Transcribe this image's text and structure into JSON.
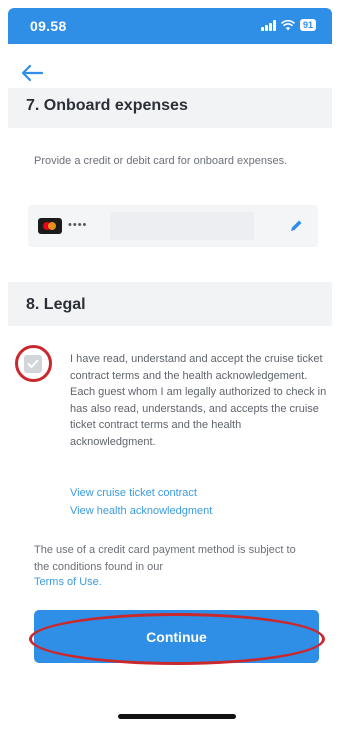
{
  "status_bar": {
    "time": "09.58",
    "battery": "91"
  },
  "section7": {
    "title": "7. Onboard expenses",
    "description": "Provide a credit or debit card for onboard expenses.",
    "card_masked": "••••"
  },
  "section8": {
    "title": "8. Legal",
    "consent_text": "I have read, understand and accept the cruise ticket contract terms and the health acknowledgement. Each guest whom I am legally authorized to check in has also read, understands, and accepts the cruise ticket contract terms and the health acknowledgment.",
    "link_contract": "View cruise ticket contract",
    "link_health": "View health acknowledgment",
    "payment_notice": "The use of a credit card payment method is subject to the conditions found in our",
    "terms_link": "Terms of Use."
  },
  "actions": {
    "continue_label": "Continue"
  },
  "colors": {
    "primary": "#2f8fe6",
    "annotation_red": "#c9282d",
    "link": "#3d9be0"
  }
}
